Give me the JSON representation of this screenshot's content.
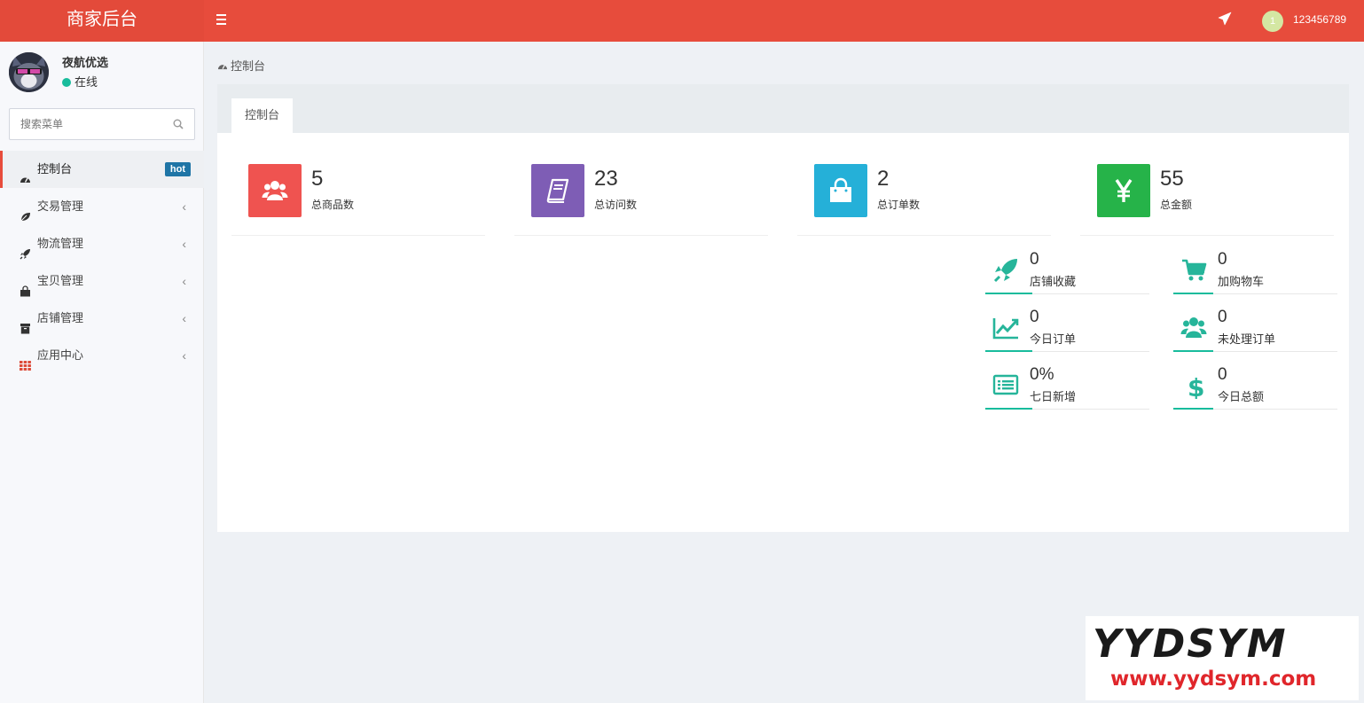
{
  "header": {
    "brand": "商家后台",
    "user_badge": "1",
    "username": "123456789"
  },
  "sidebar": {
    "user": {
      "name": "夜航优选",
      "status": "在线"
    },
    "search": {
      "placeholder": "搜索菜单"
    },
    "items": [
      {
        "label": "控制台",
        "icon": "dashboard-icon",
        "badge": "hot",
        "active": true
      },
      {
        "label": "交易管理",
        "icon": "leaf-icon"
      },
      {
        "label": "物流管理",
        "icon": "rocket-icon"
      },
      {
        "label": "宝贝管理",
        "icon": "shopping-bag-icon"
      },
      {
        "label": "店铺管理",
        "icon": "archive-icon"
      },
      {
        "label": "应用中心",
        "icon": "grid-icon"
      }
    ]
  },
  "breadcrumb": {
    "label": "控制台"
  },
  "tabs": [
    {
      "label": "控制台"
    }
  ],
  "stats": [
    {
      "value": "5",
      "label": "总商品数",
      "icon": "users-icon",
      "color": "#ef5350"
    },
    {
      "value": "23",
      "label": "总访问数",
      "icon": "book-icon",
      "color": "#7e5db5"
    },
    {
      "value": "2",
      "label": "总订单数",
      "icon": "shopping-bag-icon",
      "color": "#25b0d8"
    },
    {
      "value": "55",
      "label": "总金额",
      "icon": "yen-icon",
      "color": "#26b349"
    }
  ],
  "mini_stats": [
    {
      "value": "0",
      "label": "店铺收藏",
      "icon": "rocket-icon"
    },
    {
      "value": "0",
      "label": "加购物车",
      "icon": "cart-icon"
    },
    {
      "value": "0",
      "label": "今日订单",
      "icon": "line-chart-icon"
    },
    {
      "value": "0",
      "label": "未处理订单",
      "icon": "users-icon"
    },
    {
      "value": "0%",
      "label": "七日新增",
      "icon": "list-icon"
    },
    {
      "value": "0",
      "label": "今日总额",
      "icon": "dollar-icon"
    }
  ],
  "watermark": {
    "big": "YYDSYM",
    "small": "www.yydsym.com"
  },
  "colors": {
    "topbar": "#e74c3c",
    "accent": "#18bc9c",
    "hot_badge": "#1f75a6"
  }
}
